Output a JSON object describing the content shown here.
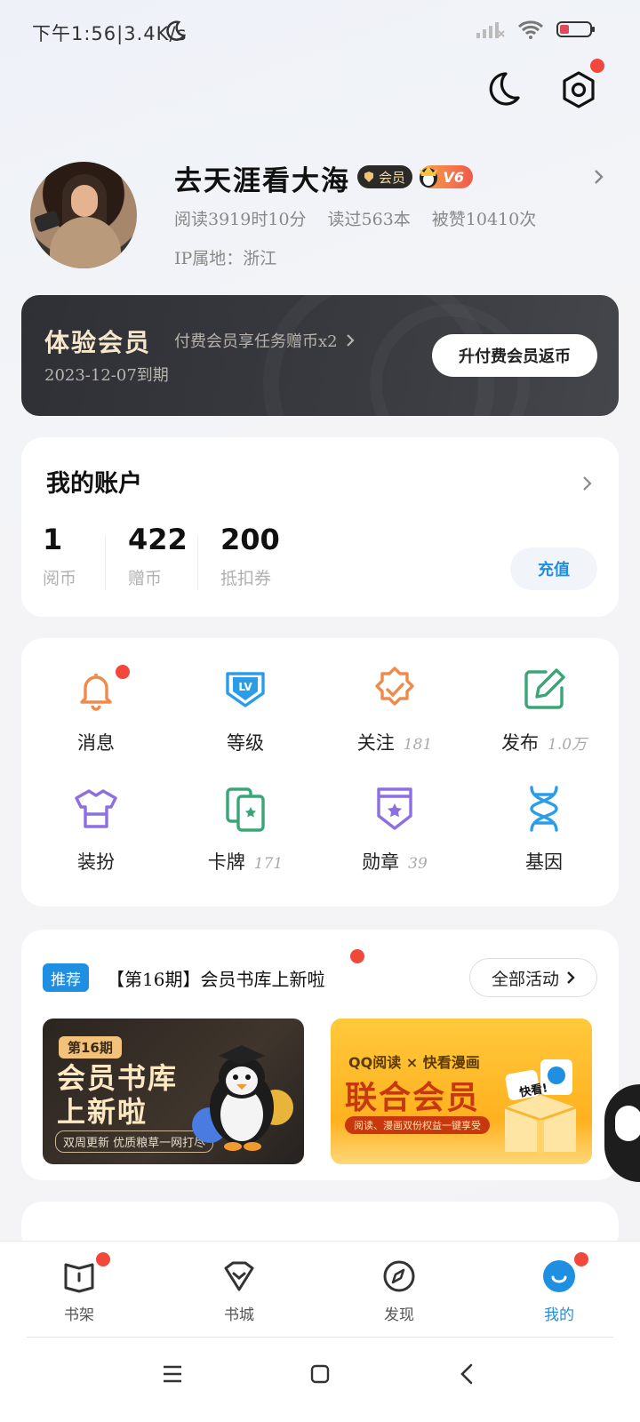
{
  "status_bar": {
    "time": "下午1:56|3.4K/s"
  },
  "profile": {
    "username": "去天涯看大海",
    "vip_label": "会员",
    "level_label": "V6",
    "stats": [
      "阅读3919时10分",
      "读过563本",
      "被赞10410次"
    ],
    "ip": "IP属地：浙江"
  },
  "membership": {
    "title": "体验会员",
    "promo": "付费会员享任务赠币x2",
    "expire": "2023-12-07到期",
    "button": "升付费会员返币"
  },
  "account": {
    "title": "我的账户",
    "items": [
      {
        "value": "1",
        "label": "阅币"
      },
      {
        "value": "422",
        "label": "赠币"
      },
      {
        "value": "200",
        "label": "抵扣券"
      }
    ],
    "recharge": "充值"
  },
  "features": [
    {
      "label": "消息",
      "count": "",
      "icon": "bell-icon",
      "color": "#f08a4b"
    },
    {
      "label": "等级",
      "count": "",
      "icon": "level-icon",
      "color": "#2b9de8"
    },
    {
      "label": "关注",
      "count": "181",
      "icon": "follow-badge-icon",
      "color": "#f08a4b"
    },
    {
      "label": "发布",
      "count": "1.0万",
      "icon": "edit-icon",
      "color": "#3aa577"
    },
    {
      "label": "装扮",
      "count": "",
      "icon": "shirt-icon",
      "color": "#8c6fe0"
    },
    {
      "label": "卡牌",
      "count": "171",
      "icon": "cards-icon",
      "color": "#3aa577"
    },
    {
      "label": "勋章",
      "count": "39",
      "icon": "medal-icon",
      "color": "#8c6fe0"
    },
    {
      "label": "基因",
      "count": "",
      "icon": "dna-icon",
      "color": "#2b9de8"
    }
  ],
  "promo": {
    "tag": "推荐",
    "text": "【第16期】会员书库上新啦",
    "all_button": "全部活动",
    "banner_left": {
      "tag": "第16期",
      "title_line1": "会员书库",
      "title_line2": "上新啦",
      "subtitle": "双周更新 优质粮草一网打尽"
    },
    "banner_right": {
      "top": "QQ阅读 × 快看漫画",
      "title": "联合会员",
      "subtitle": "阅读、漫画双份权益一键享受",
      "sign": "快看!"
    }
  },
  "bottom_nav": [
    {
      "label": "书架",
      "active": false
    },
    {
      "label": "书城",
      "active": false
    },
    {
      "label": "发现",
      "active": false
    },
    {
      "label": "我的",
      "active": true
    }
  ],
  "colors": {
    "accent": "#1e8fe1",
    "red_dot": "#f2483b",
    "member_card": "#35363b"
  }
}
